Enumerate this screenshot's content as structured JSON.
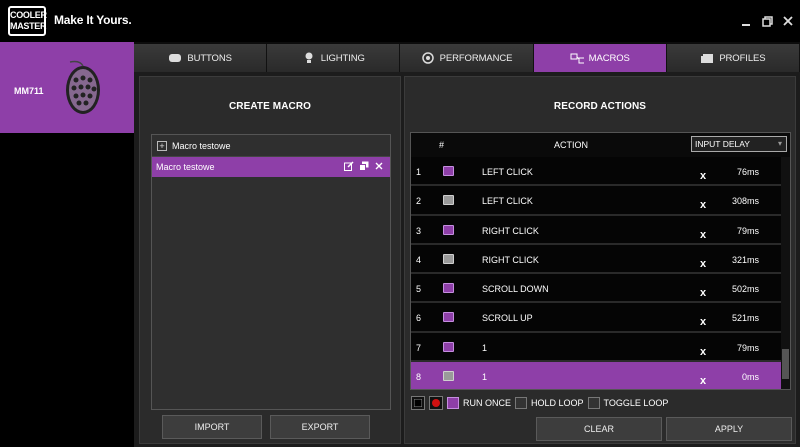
{
  "app": {
    "logo_line1": "COOLER",
    "logo_line2": "MASTER",
    "tagline": "Make It Yours.",
    "minimize_glyph": "▁",
    "restore_glyph": "❐",
    "close_glyph": "✕"
  },
  "device": {
    "name": "MM711",
    "icon": "mouse-icon"
  },
  "tabs": [
    {
      "label": "BUTTONS",
      "icon": "mouse-icon"
    },
    {
      "label": "LIGHTING",
      "icon": "bulb-icon"
    },
    {
      "label": "PERFORMANCE",
      "icon": "speed-icon"
    },
    {
      "label": "MACROS",
      "icon": "macro-icon"
    },
    {
      "label": "PROFILES",
      "icon": "profiles-icon"
    }
  ],
  "create_macro": {
    "title": "CREATE MACRO",
    "group_label": "Macro testowe",
    "item_label": "Macro testowe",
    "import_label": "IMPORT",
    "export_label": "EXPORT"
  },
  "record": {
    "title": "RECORD ACTIONS",
    "col_num": "#",
    "col_action": "ACTION",
    "delay_selected": "INPUT DELAY",
    "rows": [
      {
        "num": "1",
        "type": "down",
        "action": "LEFT CLICK",
        "x": "x",
        "ms": "76ms"
      },
      {
        "num": "2",
        "type": "up",
        "action": "LEFT CLICK",
        "x": "x",
        "ms": "308ms"
      },
      {
        "num": "3",
        "type": "down",
        "action": "RIGHT CLICK",
        "x": "x",
        "ms": "79ms"
      },
      {
        "num": "4",
        "type": "up",
        "action": "RIGHT CLICK",
        "x": "x",
        "ms": "321ms"
      },
      {
        "num": "5",
        "type": "down",
        "action": "SCROLL DOWN",
        "x": "x",
        "ms": "502ms"
      },
      {
        "num": "6",
        "type": "down",
        "action": "SCROLL UP",
        "x": "x",
        "ms": "521ms"
      },
      {
        "num": "7",
        "type": "down",
        "action": "1",
        "x": "x",
        "ms": "79ms"
      },
      {
        "num": "8",
        "type": "up",
        "action": "1",
        "x": "x",
        "ms": "0ms"
      }
    ],
    "selected_row": 8,
    "run_once_label": "RUN ONCE",
    "hold_loop_label": "HOLD LOOP",
    "toggle_loop_label": "TOGGLE LOOP",
    "clear_label": "CLEAR",
    "apply_label": "APPLY"
  },
  "colors": {
    "accent": "#8e3fa8"
  }
}
